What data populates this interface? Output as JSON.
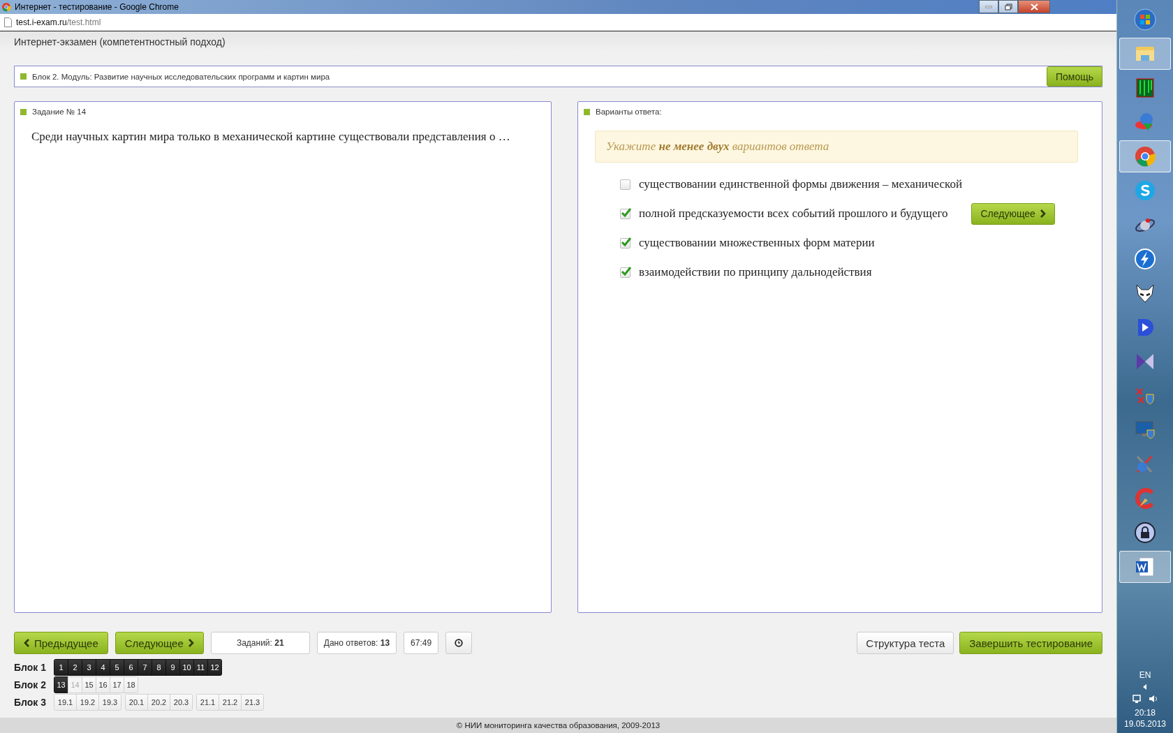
{
  "window": {
    "title": "Интернет - тестирование - Google Chrome"
  },
  "address": {
    "host": "test.i-exam.ru",
    "path": "/test.html"
  },
  "app_title": "Интернет-экзамен (компетентностный подход)",
  "block_bar": {
    "label": "Блок 2. Модуль: Развитие научных исследовательских программ и картин мира",
    "help_button": "Помощь"
  },
  "task": {
    "heading": "Задание № 14",
    "question": "Среди научных картин мира только в механической картине существовали представления о …"
  },
  "answers": {
    "heading": "Варианты ответа:",
    "hint": "Укажите **не менее двух** вариантов ответа",
    "next_button": "Следующее",
    "options": [
      {
        "text": "существовании единственной формы движения – механической",
        "checked": false
      },
      {
        "text": "полной предсказуемости всех событий прошлого и будущего",
        "checked": true
      },
      {
        "text": "существовании множественных форм материи",
        "checked": true
      },
      {
        "text": "взаимодействии по принципу дальнодействия",
        "checked": true
      }
    ]
  },
  "nav": {
    "prev_button": "Предыдущее",
    "next_button": "Следующее",
    "tasks_label": "Заданий:",
    "tasks_value": "21",
    "answered_label": "Дано ответов:",
    "answered_value": "13",
    "timer": "67:49",
    "structure_button": "Структура теста",
    "finish_button": "Завершить тестирование"
  },
  "blocks": [
    {
      "label": "Блок 1",
      "groups": [
        [
          {
            "num": "1",
            "answered": true,
            "selected": false
          },
          {
            "num": "2",
            "answered": true,
            "selected": false
          },
          {
            "num": "3",
            "answered": true,
            "selected": false
          },
          {
            "num": "4",
            "answered": true,
            "selected": false
          },
          {
            "num": "5",
            "answered": true,
            "selected": false
          },
          {
            "num": "6",
            "answered": true,
            "selected": false
          },
          {
            "num": "7",
            "answered": true,
            "selected": false
          },
          {
            "num": "8",
            "answered": true,
            "selected": false
          },
          {
            "num": "9",
            "answered": true,
            "selected": false
          },
          {
            "num": "10",
            "answered": true,
            "selected": false
          },
          {
            "num": "11",
            "answered": true,
            "selected": false
          },
          {
            "num": "12",
            "answered": true,
            "selected": false
          }
        ]
      ]
    },
    {
      "label": "Блок 2",
      "groups": [
        [
          {
            "num": "13",
            "answered": true,
            "selected": false
          },
          {
            "num": "14",
            "answered": false,
            "selected": true
          },
          {
            "num": "15",
            "answered": false,
            "selected": false
          },
          {
            "num": "16",
            "answered": false,
            "selected": false
          },
          {
            "num": "17",
            "answered": false,
            "selected": false
          },
          {
            "num": "18",
            "answered": false,
            "selected": false
          }
        ]
      ]
    },
    {
      "label": "Блок 3",
      "groups": [
        [
          {
            "num": "19.1",
            "answered": false,
            "selected": false
          },
          {
            "num": "19.2",
            "answered": false,
            "selected": false
          },
          {
            "num": "19.3",
            "answered": false,
            "selected": false
          }
        ],
        [
          {
            "num": "20.1",
            "answered": false,
            "selected": false
          },
          {
            "num": "20.2",
            "answered": false,
            "selected": false
          },
          {
            "num": "20.3",
            "answered": false,
            "selected": false
          }
        ],
        [
          {
            "num": "21.1",
            "answered": false,
            "selected": false
          },
          {
            "num": "21.2",
            "answered": false,
            "selected": false
          },
          {
            "num": "21.3",
            "answered": false,
            "selected": false
          }
        ]
      ]
    }
  ],
  "footer": "© НИИ мониторинга качества образования, 2009-2013",
  "taskbar": {
    "icons": [
      {
        "kind": "start",
        "selected": false
      },
      {
        "kind": "folder",
        "selected": true
      },
      {
        "kind": "matrix",
        "selected": false
      },
      {
        "kind": "globe",
        "selected": false
      },
      {
        "kind": "chrome",
        "selected": true
      },
      {
        "kind": "skype",
        "selected": false
      },
      {
        "kind": "orbit",
        "selected": false
      },
      {
        "kind": "bolt",
        "selected": false
      },
      {
        "kind": "fox",
        "selected": false
      },
      {
        "kind": "play",
        "selected": false
      },
      {
        "kind": "bowtie",
        "selected": false
      },
      {
        "kind": "shield",
        "selected": false
      },
      {
        "kind": "monitor",
        "selected": false
      },
      {
        "kind": "tools",
        "selected": false
      },
      {
        "kind": "cleaner",
        "selected": false
      },
      {
        "kind": "lock",
        "selected": false
      },
      {
        "kind": "word",
        "selected": true
      }
    ],
    "language": "EN",
    "time": "20:18",
    "date": "19.05.2013"
  }
}
